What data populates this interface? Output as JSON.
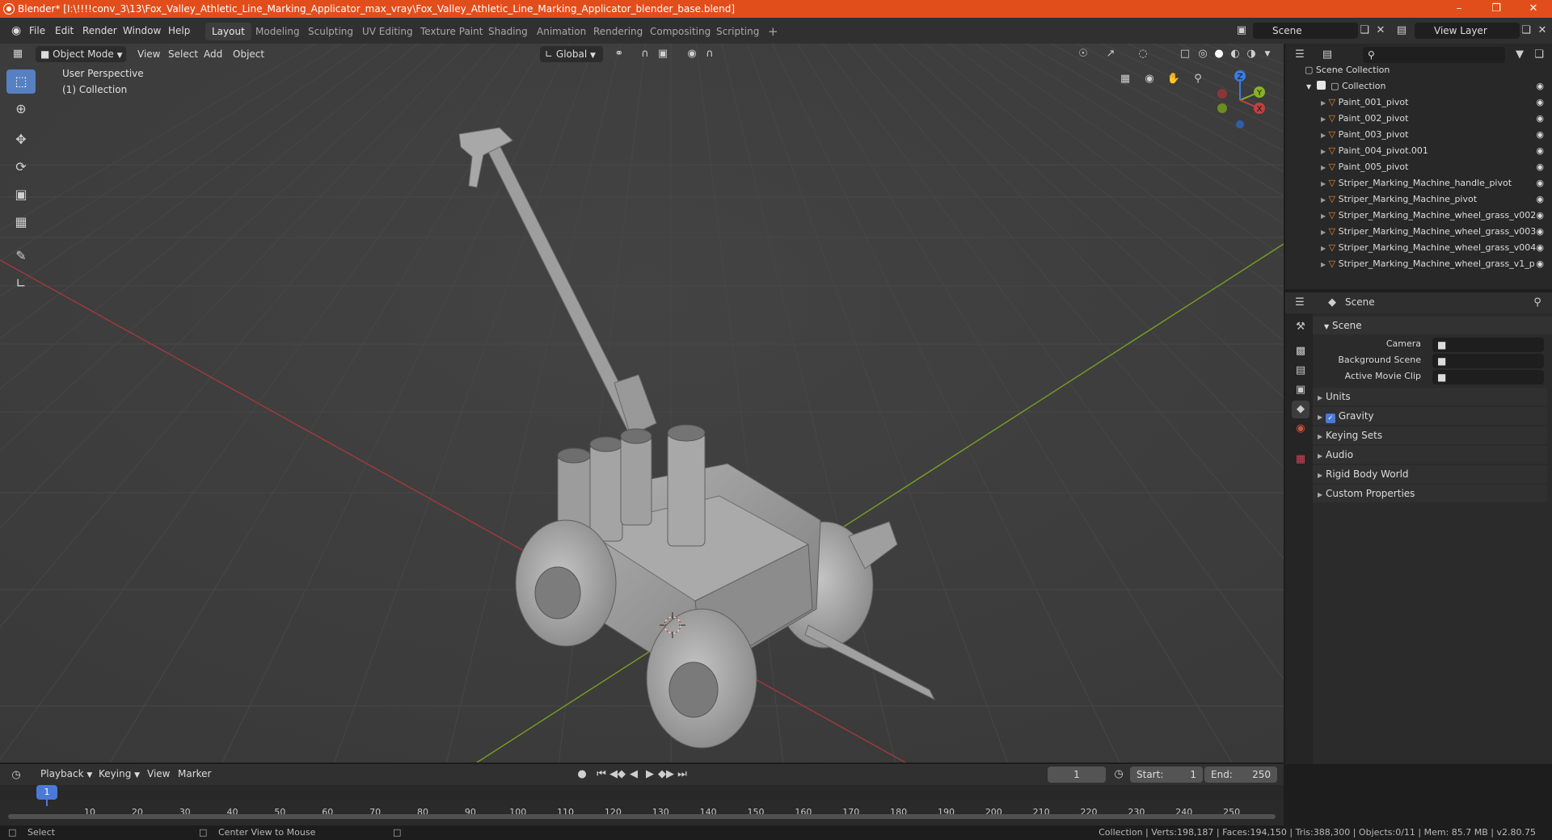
{
  "window": {
    "title": "Blender* [I:\\!!!!conv_3\\13\\Fox_Valley_Athletic_Line_Marking_Applicator_max_vray\\Fox_Valley_Athletic_Line_Marking_Applicator_blender_base.blend]"
  },
  "menu": {
    "items": [
      "File",
      "Edit",
      "Render",
      "Window",
      "Help"
    ],
    "workspaces": [
      "Layout",
      "Modeling",
      "Sculpting",
      "UV Editing",
      "Texture Paint",
      "Shading",
      "Animation",
      "Rendering",
      "Compositing",
      "Scripting"
    ],
    "active_workspace": "Layout",
    "scene": "Scene",
    "view_layer": "View Layer"
  },
  "viewport_header": {
    "mode": "Object Mode",
    "menus": [
      "View",
      "Select",
      "Add",
      "Object"
    ],
    "orientation": "Global"
  },
  "viewport": {
    "perspective": "User Perspective",
    "collection": "(1) Collection",
    "gizmo_axes": [
      "Z",
      "Y",
      "X"
    ],
    "colors": {
      "x_axis": "#c2403f",
      "y_axis": "#87b225",
      "z_axis": "#3a7be0",
      "grid": "#484848",
      "background": "#3d3d3d"
    }
  },
  "outliner": {
    "search_placeholder": "",
    "root": "Scene Collection",
    "collection": "Collection",
    "items": [
      {
        "name": "Paint_001_pivot"
      },
      {
        "name": "Paint_002_pivot"
      },
      {
        "name": "Paint_003_pivot"
      },
      {
        "name": "Paint_004_pivot.001"
      },
      {
        "name": "Paint_005_pivot"
      },
      {
        "name": "Striper_Marking_Machine_handle_pivot"
      },
      {
        "name": "Striper_Marking_Machine_pivot"
      },
      {
        "name": "Striper_Marking_Machine_wheel_grass_v002"
      },
      {
        "name": "Striper_Marking_Machine_wheel_grass_v003"
      },
      {
        "name": "Striper_Marking_Machine_wheel_grass_v004"
      },
      {
        "name": "Striper_Marking_Machine_wheel_grass_v1_p"
      }
    ]
  },
  "properties": {
    "header": "Scene",
    "panel": "Scene",
    "fields": [
      {
        "label": "Camera",
        "value": ""
      },
      {
        "label": "Background Scene",
        "value": ""
      },
      {
        "label": "Active Movie Clip",
        "value": ""
      }
    ],
    "subpanels": [
      "Units",
      "Gravity",
      "Keying Sets",
      "Audio",
      "Rigid Body World",
      "Custom Properties"
    ],
    "gravity_checked": true
  },
  "timeline": {
    "menus": [
      "Playback",
      "Keying",
      "View",
      "Marker"
    ],
    "current_frame": "1",
    "start_label": "Start:",
    "start": "1",
    "end_label": "End:",
    "end": "250",
    "ruler": [
      "1",
      "10",
      "20",
      "30",
      "40",
      "50",
      "60",
      "70",
      "80",
      "90",
      "100",
      "110",
      "120",
      "130",
      "140",
      "150",
      "160",
      "170",
      "180",
      "190",
      "200",
      "210",
      "220",
      "230",
      "240",
      "250"
    ]
  },
  "statusbar": {
    "left": "Select",
    "middle": "Center View to Mouse",
    "right": "Collection | Verts:198,187 | Faces:194,150 | Tris:388,300 | Objects:0/11 | Mem: 85.7 MB | v2.80.75"
  }
}
